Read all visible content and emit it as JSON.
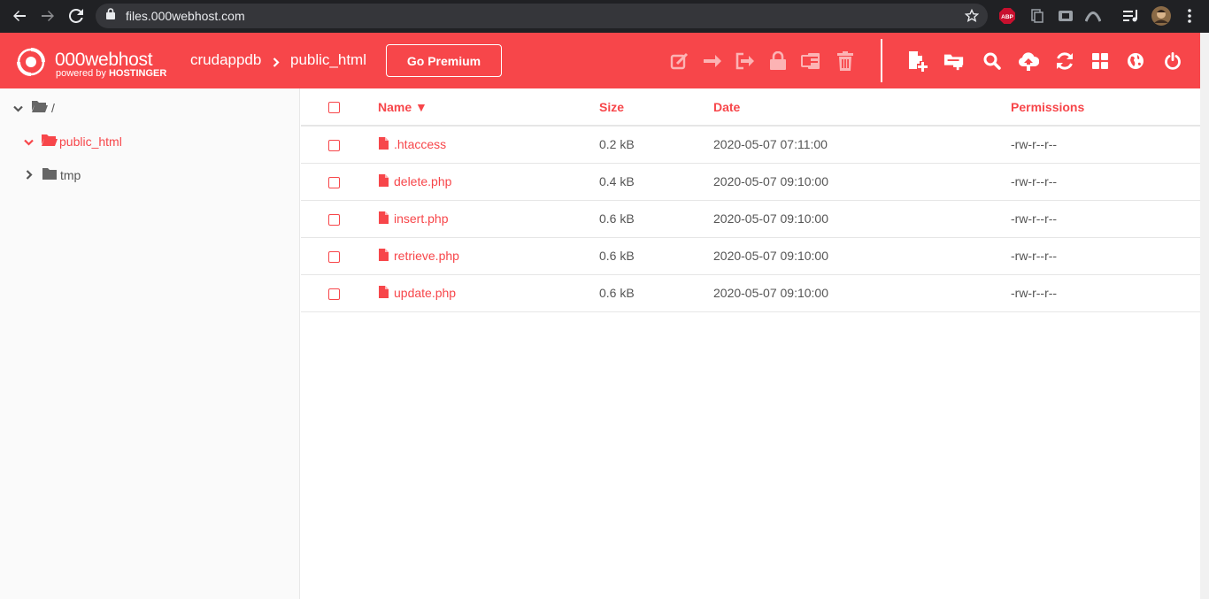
{
  "browser": {
    "url": "files.000webhost.com",
    "icons": [
      "back-icon",
      "forward-icon",
      "reload-icon",
      "lock-icon",
      "star-icon",
      "adblock-icon",
      "extension-icon",
      "extension-icon",
      "extension-icon",
      "playlist-icon",
      "profile-avatar",
      "more-icon"
    ],
    "abp_label": "ABP"
  },
  "header": {
    "logo_title": "000webhost",
    "logo_sub_prefix": "powered by ",
    "logo_sub_brand": "HOSTINGER",
    "breadcrumb": [
      "crudappdb",
      "public_html"
    ],
    "premium_label": "Go Premium",
    "colors": {
      "brand": "#f7464a",
      "text": "#ffffff"
    }
  },
  "toolbar": {
    "disabled_tools": [
      "edit-icon",
      "move-icon",
      "copy-icon",
      "lock-icon",
      "archive-icon",
      "trash-icon"
    ],
    "tools": [
      "new-file-icon",
      "new-folder-icon",
      "search-icon",
      "upload-icon",
      "refresh-icon",
      "grid-view-icon",
      "globe-icon",
      "power-icon"
    ]
  },
  "sidebar": {
    "tree": [
      {
        "label": "/",
        "expanded": true,
        "active": false
      },
      {
        "label": "public_html",
        "expanded": true,
        "active": true
      },
      {
        "label": "tmp",
        "expanded": false,
        "active": false
      }
    ]
  },
  "table": {
    "columns": {
      "name": "Name ▼",
      "size": "Size",
      "date": "Date",
      "permissions": "Permissions"
    },
    "rows": [
      {
        "name": ".htaccess",
        "size": "0.2 kB",
        "date": "2020-05-07 07:11:00",
        "perm": "-rw-r--r--"
      },
      {
        "name": "delete.php",
        "size": "0.4 kB",
        "date": "2020-05-07 09:10:00",
        "perm": "-rw-r--r--"
      },
      {
        "name": "insert.php",
        "size": "0.6 kB",
        "date": "2020-05-07 09:10:00",
        "perm": "-rw-r--r--"
      },
      {
        "name": "retrieve.php",
        "size": "0.6 kB",
        "date": "2020-05-07 09:10:00",
        "perm": "-rw-r--r--"
      },
      {
        "name": "update.php",
        "size": "0.6 kB",
        "date": "2020-05-07 09:10:00",
        "perm": "-rw-r--r--"
      }
    ]
  }
}
